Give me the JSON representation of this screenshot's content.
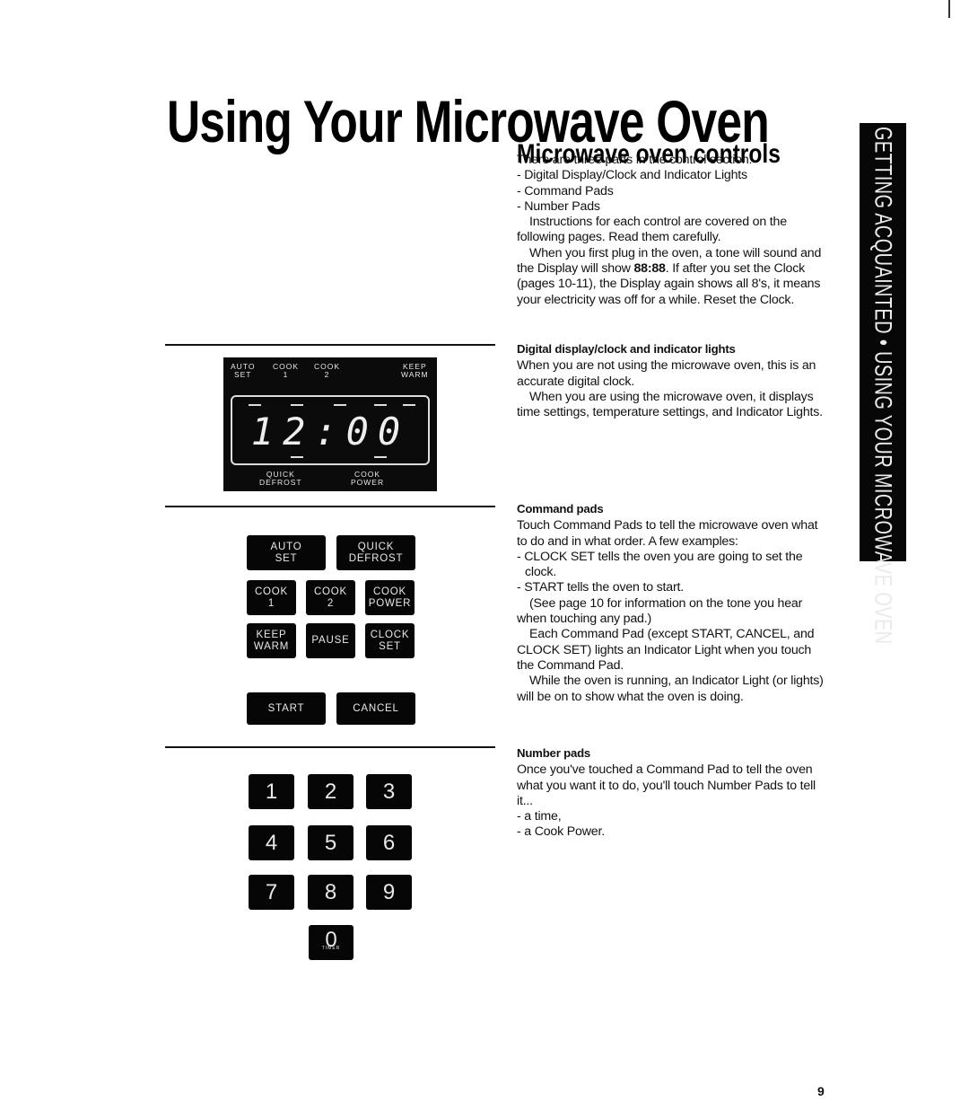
{
  "page": {
    "title": "Using Your Microwave Oven",
    "page_number": "9",
    "side_tab": "GETTING ACQUAINTED • USING YOUR MICROWAVE OVEN"
  },
  "controls": {
    "heading": "Microwave oven controls",
    "intro": "There are three parts in the control section:",
    "parts": [
      "- Digital Display/Clock and Indicator Lights",
      "- Command Pads",
      "- Number Pads"
    ],
    "para1": "Instructions for each control are covered on the following pages. Read them carefully.",
    "para2_a": "When you first plug in the oven, a tone will sound and the Display will show ",
    "para2_bold": "88:88",
    "para2_b": ". If after you set the Clock (pages 10-11), the Display again shows all 8's, it means your electricity was off for a while. Reset the Clock."
  },
  "display_section": {
    "heading": "Digital display/clock and indicator lights",
    "para1": "When you are not using the microwave oven, this is an accurate digital clock.",
    "para2": "When you are using the microwave oven, it displays time settings, temperature settings, and Indicator Lights."
  },
  "command_section": {
    "heading": "Command pads",
    "para1": "Touch Command Pads to tell the microwave oven what to do and in what order. A few examples:",
    "bullet1": "- CLOCK SET tells the oven you are going to set the clock.",
    "bullet2": "- START tells the oven to start.",
    "para2": "(See page 10 for information on the tone you hear when touching any pad.)",
    "para3": "Each Command Pad (except START, CANCEL, and CLOCK SET) lights an Indicator Light when you touch the Command Pad.",
    "para4": "While the oven is running, an Indicator Light (or lights) will be on to show what the oven is doing."
  },
  "number_section": {
    "heading": "Number pads",
    "para1": "Once you've touched a Command Pad to tell the oven what you want it to do, you'll touch Number Pads to tell it...",
    "bullet1": "- a time,",
    "bullet2": "- a Cook Power."
  },
  "display_panel": {
    "top_labels": [
      "AUTO\nSET",
      "COOK\n1",
      "COOK\n2",
      "KEEP\nWARM"
    ],
    "bottom_labels": [
      "QUICK\nDEFROST",
      "COOK\nPOWER"
    ],
    "time": "12:00"
  },
  "command_pads": {
    "auto_set": "AUTO\nSET",
    "quick_defrost": "QUICK\nDEFROST",
    "cook_1": "COOK\n1",
    "cook_2": "COOK\n2",
    "cook_power": "COOK\nPOWER",
    "keep_warm": "KEEP\nWARM",
    "pause": "PAUSE",
    "clock_set": "CLOCK\nSET",
    "start": "START",
    "cancel": "CANCEL"
  },
  "number_pads": {
    "keys": [
      "1",
      "2",
      "3",
      "4",
      "5",
      "6",
      "7",
      "8",
      "9",
      "0"
    ],
    "zero_sub": "TIMER"
  }
}
